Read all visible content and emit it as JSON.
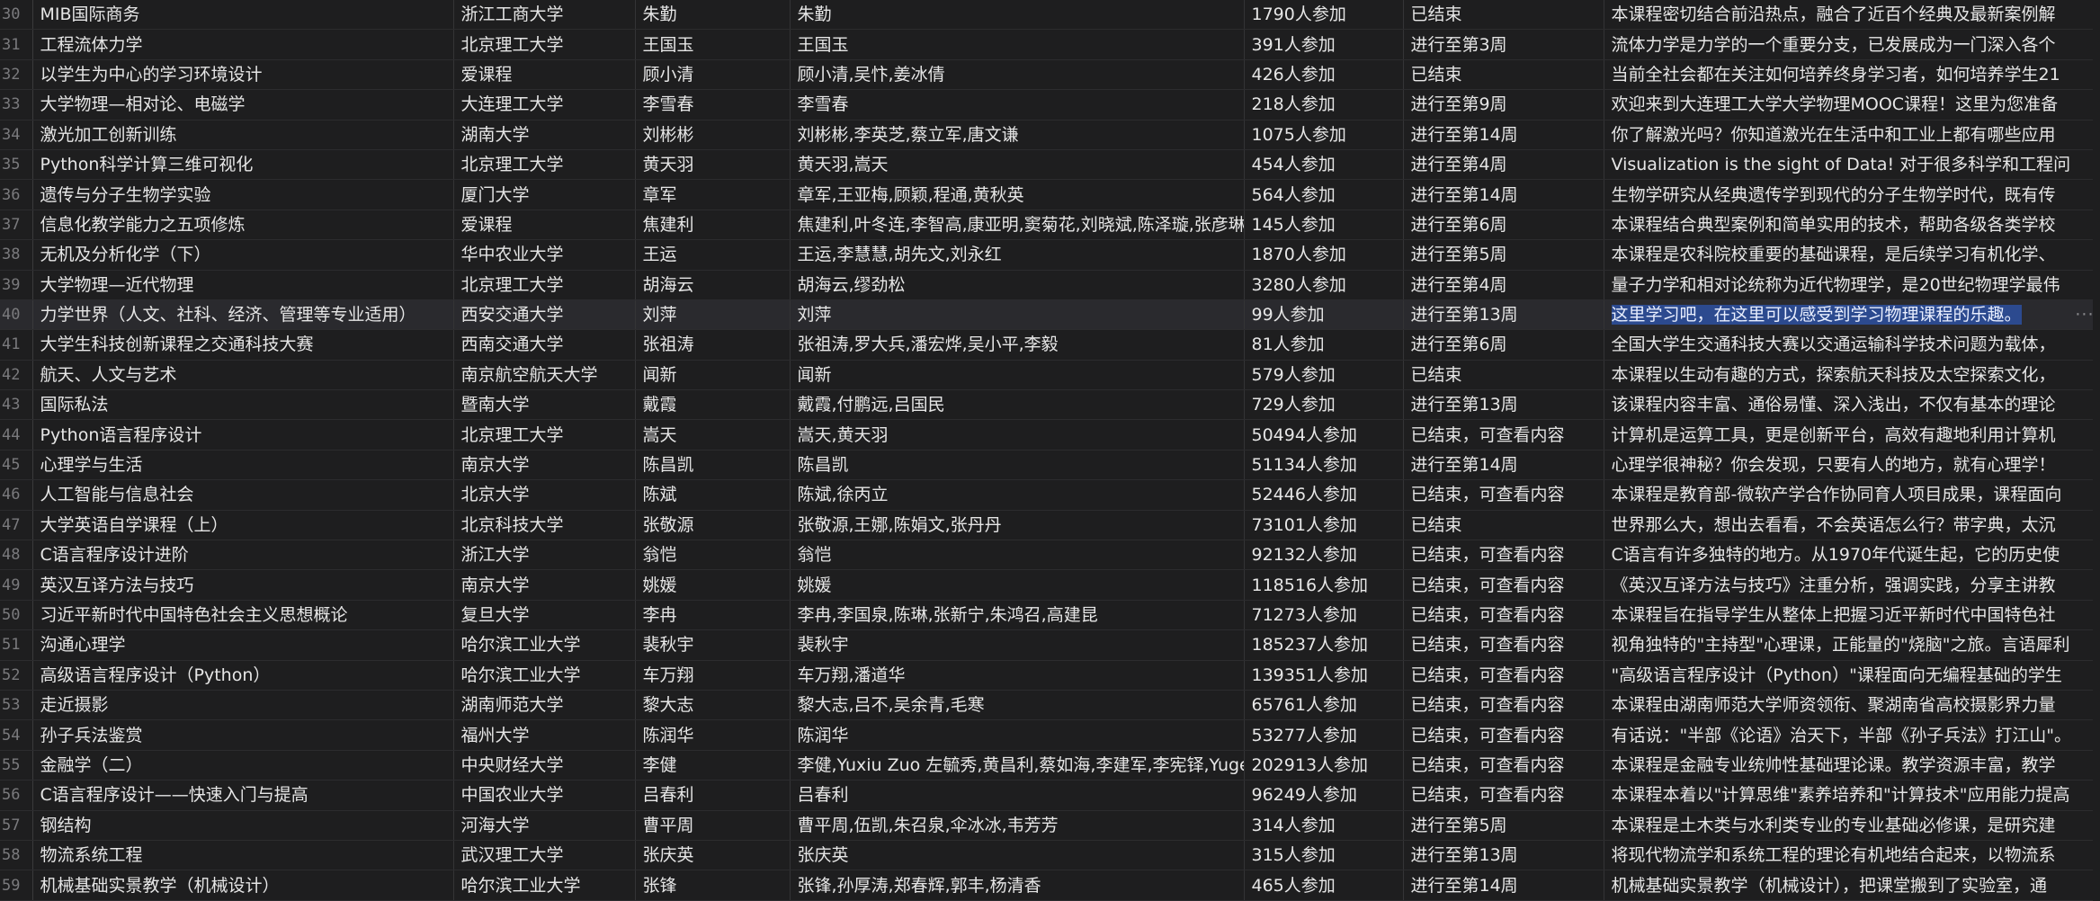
{
  "rows": [
    {
      "ln": "30",
      "name": "MIB国际商务",
      "school": "浙江工商大学",
      "teacher": "朱勤",
      "team": "朱勤",
      "count": "1790人参加",
      "status": "已结束",
      "intro": "本课程密切结合前沿热点，融合了近百个经典及最新案例解"
    },
    {
      "ln": "31",
      "name": "工程流体力学",
      "school": "北京理工大学",
      "teacher": "王国玉",
      "team": "王国玉",
      "count": "391人参加",
      "status": "进行至第3周",
      "intro": "流体力学是力学的一个重要分支，已发展成为一门深入各个"
    },
    {
      "ln": "32",
      "name": "以学生为中心的学习环境设计",
      "school": "爱课程",
      "teacher": "顾小清",
      "team": "顾小清,吴忭,姜冰倩",
      "count": "426人参加",
      "status": "已结束",
      "intro": "当前全社会都在关注如何培养终身学习者，如何培养学生21"
    },
    {
      "ln": "33",
      "name": "大学物理—相对论、电磁学",
      "school": "大连理工大学",
      "teacher": "李雪春",
      "team": "李雪春",
      "count": "218人参加",
      "status": "进行至第9周",
      "intro": "欢迎来到大连理工大学大学物理MOOC课程！这里为您准备"
    },
    {
      "ln": "34",
      "name": "激光加工创新训练",
      "school": "湖南大学",
      "teacher": "刘彬彬",
      "team": "刘彬彬,李英芝,蔡立军,唐文谦",
      "count": "1075人参加",
      "status": "进行至第14周",
      "intro": "你了解激光吗？你知道激光在生活中和工业上都有哪些应用"
    },
    {
      "ln": "35",
      "name": "Python科学计算三维可视化",
      "school": "北京理工大学",
      "teacher": "黄天羽",
      "team": "黄天羽,嵩天",
      "count": "454人参加",
      "status": "进行至第4周",
      "intro": "Visualization is the sight of Data! 对于很多科学和工程问"
    },
    {
      "ln": "36",
      "name": "遗传与分子生物学实验",
      "school": "厦门大学",
      "teacher": "章军",
      "team": "章军,王亚梅,顾颖,程通,黄秋英",
      "count": "564人参加",
      "status": "进行至第14周",
      "intro": "生物学研究从经典遗传学到现代的分子生物学时代，既有传"
    },
    {
      "ln": "37",
      "name": "信息化教学能力之五项修炼",
      "school": "爱课程",
      "teacher": "焦建利",
      "team": "焦建利,叶冬连,李智高,康亚明,窦菊花,刘晓斌,陈泽璇,张彦琳,",
      "count": "145人参加",
      "status": "进行至第6周",
      "intro": "本课程结合典型案例和简单实用的技术，帮助各级各类学校"
    },
    {
      "ln": "38",
      "name": "无机及分析化学（下）",
      "school": "华中农业大学",
      "teacher": "王运",
      "team": "王运,李慧慧,胡先文,刘永红",
      "count": "1870人参加",
      "status": "进行至第5周",
      "intro": "本课程是农科院校重要的基础课程，是后续学习有机化学、"
    },
    {
      "ln": "39",
      "name": "大学物理—近代物理",
      "school": "北京理工大学",
      "teacher": "胡海云",
      "team": "胡海云,缪劲松",
      "count": "3280人参加",
      "status": "进行至第4周",
      "intro": "量子力学和相对论统称为近代物理学，是20世纪物理学最伟"
    },
    {
      "ln": "40",
      "name": "力学世界（人文、社科、经济、管理等专业适用）",
      "school": "西安交通大学",
      "teacher": "刘萍",
      "team": "刘萍",
      "count": "99人参加",
      "status": "进行至第13周",
      "intro": "这里学习吧，在这里可以感受到学习物理课程的乐趣。"
    },
    {
      "ln": "41",
      "name": "大学生科技创新课程之交通科技大赛",
      "school": "西南交通大学",
      "teacher": "张祖涛",
      "team": "张祖涛,罗大兵,潘宏烨,吴小平,李毅",
      "count": "81人参加",
      "status": "进行至第6周",
      "intro": "全国大学生交通科技大赛以交通运输科学技术问题为载体，"
    },
    {
      "ln": "42",
      "name": "航天、人文与艺术",
      "school": "南京航空航天大学",
      "teacher": "闻新",
      "team": "闻新",
      "count": "579人参加",
      "status": "已结束",
      "intro": "本课程以生动有趣的方式，探索航天科技及太空探索文化，"
    },
    {
      "ln": "43",
      "name": "国际私法",
      "school": "暨南大学",
      "teacher": "戴霞",
      "team": "戴霞,付鹏远,吕国民",
      "count": "729人参加",
      "status": "进行至第13周",
      "intro": "该课程内容丰富、通俗易懂、深入浅出，不仅有基本的理论"
    },
    {
      "ln": "44",
      "name": "Python语言程序设计",
      "school": "北京理工大学",
      "teacher": "嵩天",
      "team": "嵩天,黄天羽",
      "count": "50494人参加",
      "status": "已结束，可查看内容",
      "intro": "计算机是运算工具，更是创新平台，高效有趣地利用计算机"
    },
    {
      "ln": "45",
      "name": "心理学与生活",
      "school": "南京大学",
      "teacher": "陈昌凯",
      "team": "陈昌凯",
      "count": "51134人参加",
      "status": "进行至第14周",
      "intro": "心理学很神秘？你会发现，只要有人的地方，就有心理学！"
    },
    {
      "ln": "46",
      "name": "人工智能与信息社会",
      "school": "北京大学",
      "teacher": "陈斌",
      "team": "陈斌,徐丙立",
      "count": "52446人参加",
      "status": "已结束，可查看内容",
      "intro": "本课程是教育部-微软产学合作协同育人项目成果，课程面向"
    },
    {
      "ln": "47",
      "name": "大学英语自学课程（上）",
      "school": "北京科技大学",
      "teacher": "张敬源",
      "team": "张敬源,王娜,陈娟文,张丹丹",
      "count": "73101人参加",
      "status": "已结束",
      "intro": "世界那么大，想出去看看，不会英语怎么行？带字典，太沉"
    },
    {
      "ln": "48",
      "name": "C语言程序设计进阶",
      "school": "浙江大学",
      "teacher": "翁恺",
      "team": "翁恺",
      "count": "92132人参加",
      "status": "已结束，可查看内容",
      "intro": "C语言有许多独特的地方。从1970年代诞生起，它的历史使"
    },
    {
      "ln": "49",
      "name": "英汉互译方法与技巧",
      "school": "南京大学",
      "teacher": "姚媛",
      "team": "姚媛",
      "count": "118516人参加",
      "status": "已结束，可查看内容",
      "intro": "《英汉互译方法与技巧》注重分析，强调实践，分享主讲教"
    },
    {
      "ln": "50",
      "name": "习近平新时代中国特色社会主义思想概论",
      "school": "复旦大学",
      "teacher": "李冉",
      "team": "李冉,李国泉,陈琳,张新宁,朱鸿召,高建昆",
      "count": "71273人参加",
      "status": "已结束，可查看内容",
      "intro": "本课程旨在指导学生从整体上把握习近平新时代中国特色社"
    },
    {
      "ln": "51",
      "name": "沟通心理学",
      "school": "哈尔滨工业大学",
      "teacher": "裴秋宇",
      "team": "裴秋宇",
      "count": "185237人参加",
      "status": "已结束，可查看内容",
      "intro": "视角独特的\"主持型\"心理课，正能量的\"烧脑\"之旅。言语犀利"
    },
    {
      "ln": "52",
      "name": "高级语言程序设计（Python）",
      "school": "哈尔滨工业大学",
      "teacher": "车万翔",
      "team": "车万翔,潘道华",
      "count": "139351人参加",
      "status": "已结束，可查看内容",
      "intro": "\"高级语言程序设计（Python）\"课程面向无编程基础的学生"
    },
    {
      "ln": "53",
      "name": "走近摄影",
      "school": "湖南师范大学",
      "teacher": "黎大志",
      "team": "黎大志,吕不,吴余青,毛寒",
      "count": "65761人参加",
      "status": "已结束，可查看内容",
      "intro": "本课程由湖南师范大学师资领衔、聚湖南省高校摄影界力量"
    },
    {
      "ln": "54",
      "name": "孙子兵法鉴赏",
      "school": "福州大学",
      "teacher": "陈润华",
      "team": "陈润华",
      "count": "53277人参加",
      "status": "已结束，可查看内容",
      "intro": "有话说：\"半部《论语》治天下，半部《孙子兵法》打江山\"。"
    },
    {
      "ln": "55",
      "name": "金融学（二）",
      "school": "中央财经大学",
      "teacher": "李健",
      "team": "李健,Yuxiu Zuo 左毓秀,黄昌利,蔡如海,李建军,李宪铎,Yuge",
      "count": "202913人参加",
      "status": "已结束，可查看内容",
      "intro": "本课程是金融专业统帅性基础理论课。教学资源丰富，教学"
    },
    {
      "ln": "56",
      "name": "C语言程序设计——快速入门与提高",
      "school": "中国农业大学",
      "teacher": "吕春利",
      "team": "吕春利",
      "count": "96249人参加",
      "status": "已结束，可查看内容",
      "intro": "本课程本着以\"计算思维\"素养培养和\"计算技术\"应用能力提高"
    },
    {
      "ln": "57",
      "name": "钢结构",
      "school": "河海大学",
      "teacher": "曹平周",
      "team": "曹平周,伍凯,朱召泉,伞冰冰,韦芳芳",
      "count": "314人参加",
      "status": "进行至第5周",
      "intro": "本课程是土木类与水利类专业的专业基础必修课，是研究建"
    },
    {
      "ln": "58",
      "name": "物流系统工程",
      "school": "武汉理工大学",
      "teacher": "张庆英",
      "team": "张庆英",
      "count": "315人参加",
      "status": "进行至第13周",
      "intro": "将现代物流学和系统工程的理论有机地结合起来，以物流系"
    },
    {
      "ln": "59",
      "name": "机械基础实景教学（机械设计）",
      "school": "哈尔滨工业大学",
      "teacher": "张锋",
      "team": "张锋,孙厚涛,郑春辉,郭丰,杨清香",
      "count": "465人参加",
      "status": "进行至第14周",
      "intro": "机械基础实景教学（机械设计），把课堂搬到了实验室，通"
    }
  ],
  "ellipsis_label": "···",
  "colors": {
    "background": "#1e1e1f",
    "selection": "#2c4a8f",
    "gridline": "#343436"
  }
}
